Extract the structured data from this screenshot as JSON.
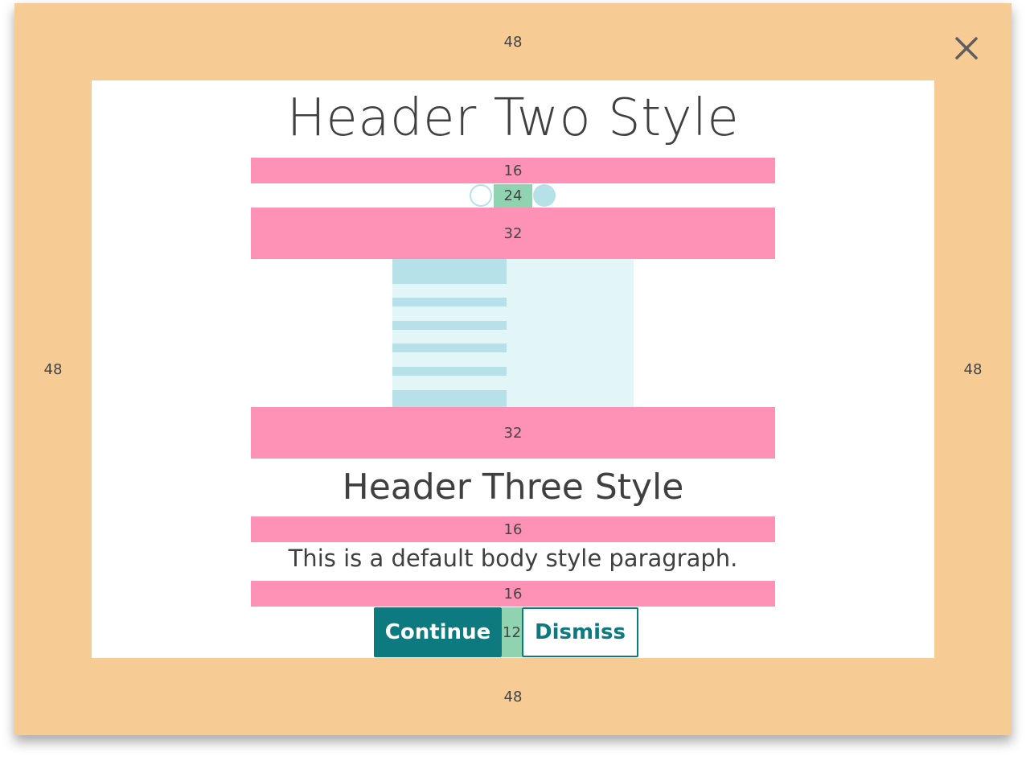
{
  "modal": {
    "padding_labels": {
      "top": "48",
      "left": "48",
      "right": "48",
      "bottom": "48"
    },
    "close_icon": "close-icon"
  },
  "content": {
    "header_two": "Header Two Style",
    "spacer_after_header": "16",
    "carousel_spacing": "24",
    "spacer_before_image": "32",
    "spacer_after_image": "32",
    "header_three": "Header Three Style",
    "spacer_after_header_three": "16",
    "body_paragraph": "This is a default body style paragraph.",
    "spacer_after_body": "16",
    "button_gap": "12",
    "continue_label": "Continue",
    "dismiss_label": "Dismiss"
  },
  "colors": {
    "modal_padding": "#f6cb94",
    "spacer": "#fe92b6",
    "gap": "#8fd3b0",
    "primary": "#0c7a7e",
    "image_dark": "#b7e1e9",
    "image_light": "#e2f6f8"
  }
}
